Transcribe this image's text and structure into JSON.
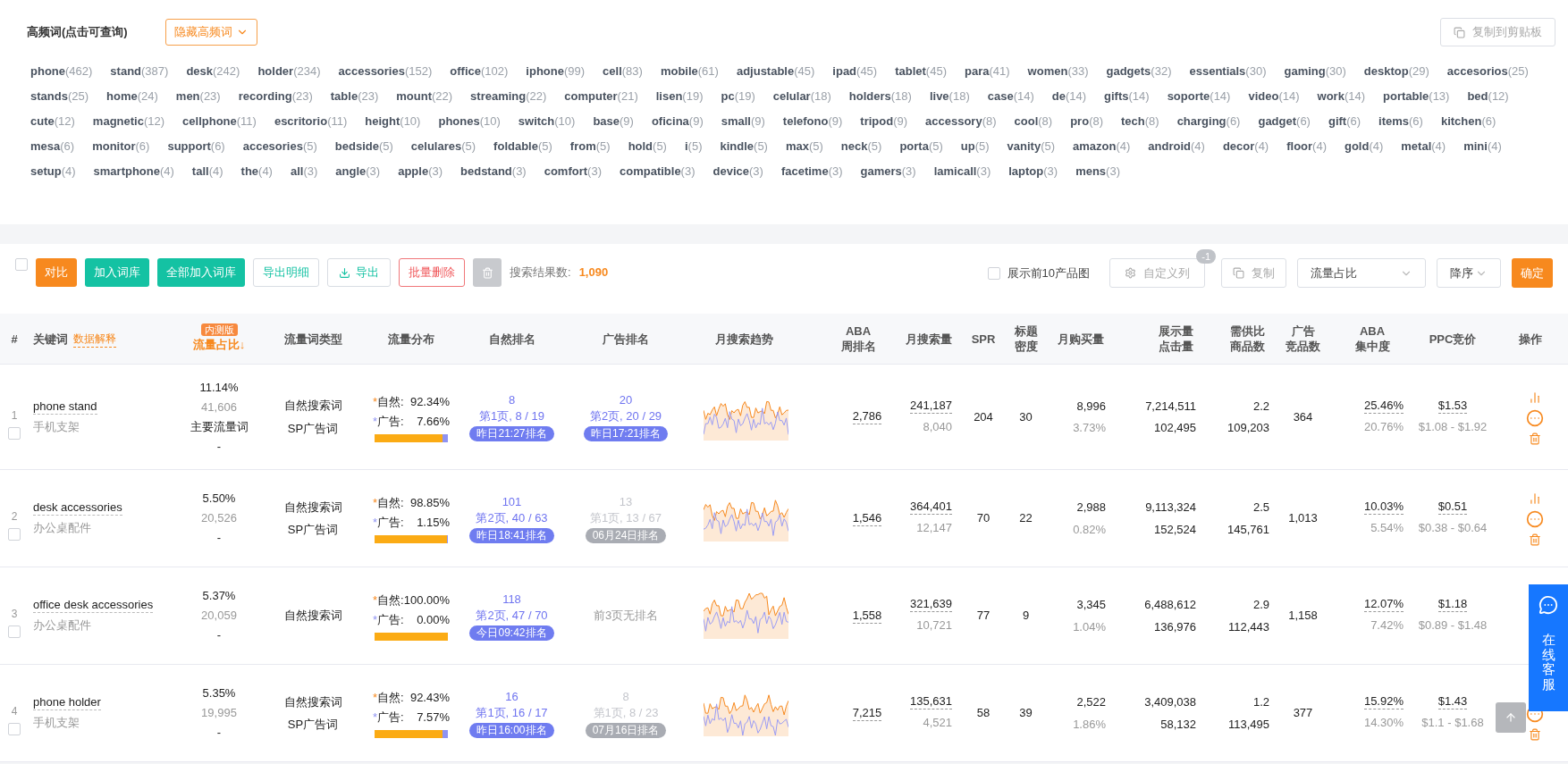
{
  "keywords_panel": {
    "title": "高频词(点击可查询)",
    "toggle_button": "隐藏高频词",
    "copy_button": "复制到剪贴板",
    "tags": [
      {
        "word": "phone",
        "count": "(462)"
      },
      {
        "word": "stand",
        "count": "(387)"
      },
      {
        "word": "desk",
        "count": "(242)"
      },
      {
        "word": "holder",
        "count": "(234)"
      },
      {
        "word": "accessories",
        "count": "(152)"
      },
      {
        "word": "office",
        "count": "(102)"
      },
      {
        "word": "iphone",
        "count": "(99)"
      },
      {
        "word": "cell",
        "count": "(83)"
      },
      {
        "word": "mobile",
        "count": "(61)"
      },
      {
        "word": "adjustable",
        "count": "(45)"
      },
      {
        "word": "ipad",
        "count": "(45)"
      },
      {
        "word": "tablet",
        "count": "(45)"
      },
      {
        "word": "para",
        "count": "(41)"
      },
      {
        "word": "women",
        "count": "(33)"
      },
      {
        "word": "gadgets",
        "count": "(32)"
      },
      {
        "word": "essentials",
        "count": "(30)"
      },
      {
        "word": "gaming",
        "count": "(30)"
      },
      {
        "word": "desktop",
        "count": "(29)"
      },
      {
        "word": "accesorios",
        "count": "(25)"
      },
      {
        "word": "stands",
        "count": "(25)"
      },
      {
        "word": "home",
        "count": "(24)"
      },
      {
        "word": "men",
        "count": "(23)"
      },
      {
        "word": "recording",
        "count": "(23)"
      },
      {
        "word": "table",
        "count": "(23)"
      },
      {
        "word": "mount",
        "count": "(22)"
      },
      {
        "word": "streaming",
        "count": "(22)"
      },
      {
        "word": "computer",
        "count": "(21)"
      },
      {
        "word": "lisen",
        "count": "(19)"
      },
      {
        "word": "pc",
        "count": "(19)"
      },
      {
        "word": "celular",
        "count": "(18)"
      },
      {
        "word": "holders",
        "count": "(18)"
      },
      {
        "word": "live",
        "count": "(18)"
      },
      {
        "word": "case",
        "count": "(14)"
      },
      {
        "word": "de",
        "count": "(14)"
      },
      {
        "word": "gifts",
        "count": "(14)"
      },
      {
        "word": "soporte",
        "count": "(14)"
      },
      {
        "word": "video",
        "count": "(14)"
      },
      {
        "word": "work",
        "count": "(14)"
      },
      {
        "word": "portable",
        "count": "(13)"
      },
      {
        "word": "bed",
        "count": "(12)"
      },
      {
        "word": "cute",
        "count": "(12)"
      },
      {
        "word": "magnetic",
        "count": "(12)"
      },
      {
        "word": "cellphone",
        "count": "(11)"
      },
      {
        "word": "escritorio",
        "count": "(11)"
      },
      {
        "word": "height",
        "count": "(10)"
      },
      {
        "word": "phones",
        "count": "(10)"
      },
      {
        "word": "switch",
        "count": "(10)"
      },
      {
        "word": "base",
        "count": "(9)"
      },
      {
        "word": "oficina",
        "count": "(9)"
      },
      {
        "word": "small",
        "count": "(9)"
      },
      {
        "word": "telefono",
        "count": "(9)"
      },
      {
        "word": "tripod",
        "count": "(9)"
      },
      {
        "word": "accessory",
        "count": "(8)"
      },
      {
        "word": "cool",
        "count": "(8)"
      },
      {
        "word": "pro",
        "count": "(8)"
      },
      {
        "word": "tech",
        "count": "(8)"
      },
      {
        "word": "charging",
        "count": "(6)"
      },
      {
        "word": "gadget",
        "count": "(6)"
      },
      {
        "word": "gift",
        "count": "(6)"
      },
      {
        "word": "items",
        "count": "(6)"
      },
      {
        "word": "kitchen",
        "count": "(6)"
      },
      {
        "word": "mesa",
        "count": "(6)"
      },
      {
        "word": "monitor",
        "count": "(6)"
      },
      {
        "word": "support",
        "count": "(6)"
      },
      {
        "word": "accesories",
        "count": "(5)"
      },
      {
        "word": "bedside",
        "count": "(5)"
      },
      {
        "word": "celulares",
        "count": "(5)"
      },
      {
        "word": "foldable",
        "count": "(5)"
      },
      {
        "word": "from",
        "count": "(5)"
      },
      {
        "word": "hold",
        "count": "(5)"
      },
      {
        "word": "i",
        "count": "(5)"
      },
      {
        "word": "kindle",
        "count": "(5)"
      },
      {
        "word": "max",
        "count": "(5)"
      },
      {
        "word": "neck",
        "count": "(5)"
      },
      {
        "word": "porta",
        "count": "(5)"
      },
      {
        "word": "up",
        "count": "(5)"
      },
      {
        "word": "vanity",
        "count": "(5)"
      },
      {
        "word": "amazon",
        "count": "(4)"
      },
      {
        "word": "android",
        "count": "(4)"
      },
      {
        "word": "decor",
        "count": "(4)"
      },
      {
        "word": "floor",
        "count": "(4)"
      },
      {
        "word": "gold",
        "count": "(4)"
      },
      {
        "word": "metal",
        "count": "(4)"
      },
      {
        "word": "mini",
        "count": "(4)"
      },
      {
        "word": "setup",
        "count": "(4)"
      },
      {
        "word": "smartphone",
        "count": "(4)"
      },
      {
        "word": "tall",
        "count": "(4)"
      },
      {
        "word": "the",
        "count": "(4)"
      },
      {
        "word": "all",
        "count": "(3)"
      },
      {
        "word": "angle",
        "count": "(3)"
      },
      {
        "word": "apple",
        "count": "(3)"
      },
      {
        "word": "bedstand",
        "count": "(3)"
      },
      {
        "word": "comfort",
        "count": "(3)"
      },
      {
        "word": "compatible",
        "count": "(3)"
      },
      {
        "word": "device",
        "count": "(3)"
      },
      {
        "word": "facetime",
        "count": "(3)"
      },
      {
        "word": "gamers",
        "count": "(3)"
      },
      {
        "word": "lamicall",
        "count": "(3)"
      },
      {
        "word": "laptop",
        "count": "(3)"
      },
      {
        "word": "mens",
        "count": "(3)"
      }
    ]
  },
  "toolbar": {
    "select_all": {
      "checked": false
    },
    "buttons": [
      {
        "label": "对比",
        "kind": "orange"
      },
      {
        "label": "加入词库",
        "kind": "green"
      },
      {
        "label": "全部加入词库",
        "kind": "green"
      },
      {
        "label": "导出明细",
        "kind": "outline-green"
      },
      {
        "label": "导出",
        "kind": "download"
      },
      {
        "label": "批量删除",
        "kind": "outline-red"
      },
      {
        "kind": "trash"
      }
    ],
    "result_label": "搜索结果数:",
    "result_count": "1,090",
    "show_images": {
      "label": "展示前10产品图",
      "checked": false
    },
    "custom_columns": {
      "label": "自定义列",
      "badge": "-1"
    },
    "copy_button": "复制",
    "sort_field": "流量占比",
    "sort_order": "降序",
    "confirm_button": "确定"
  },
  "table": {
    "columns": [
      {
        "lines": [
          "#"
        ]
      },
      {
        "lines": [
          "关键词"
        ],
        "link": "数据解释"
      },
      {
        "lines": [
          "流量占比↓"
        ],
        "badge": "内测版",
        "selected": true
      },
      {
        "lines": [
          "流量词类型"
        ]
      },
      {
        "lines": [
          "流量分布"
        ]
      },
      {
        "lines": [
          "自然排名"
        ]
      },
      {
        "lines": [
          "广告排名"
        ]
      },
      {
        "lines": [
          "月搜索趋势"
        ]
      },
      {
        "lines": [
          "ABA",
          "周排名"
        ]
      },
      {
        "lines": [
          "月搜索量"
        ]
      },
      {
        "lines": [
          "SPR"
        ]
      },
      {
        "lines": [
          "标题",
          "密度"
        ]
      },
      {
        "lines": [
          "月购买量"
        ]
      },
      {
        "lines": [
          "展示量",
          "点击量"
        ]
      },
      {
        "lines": [
          "需供比",
          "商品数"
        ]
      },
      {
        "lines": [
          "广告",
          "竞品数"
        ]
      },
      {
        "lines": [
          "ABA",
          "集中度"
        ]
      },
      {
        "lines": [
          "PPC竞价"
        ]
      },
      {
        "lines": [
          "操作"
        ]
      }
    ],
    "rows": [
      {
        "index": "1",
        "checked": false,
        "keyword": "phone stand",
        "translation": "手机支架",
        "share": "11.14%",
        "share_count": "41,606",
        "share_tag": "主要流量词",
        "share_extra": "-",
        "types": [
          "自然搜索词",
          "SP广告词"
        ],
        "dist": {
          "natural_star": "*",
          "natural_label": "自然:",
          "natural": "92.34%",
          "ad_star": "*",
          "ad_label": "广告:",
          "ad": "7.66%",
          "level": 0.9234
        },
        "natural_rank": {
          "rank": "8",
          "page": "第1页, 8 / 19",
          "time": "昨日21:27排名",
          "active": true
        },
        "ad_rank": {
          "rank": "20",
          "page": "第2页, 20 / 29",
          "time": "昨日17:21排名",
          "active": true
        },
        "aba": "2,786",
        "search": "241,187",
        "search_sub": "8,040",
        "spr": "204",
        "title_density": "30",
        "purchase": "8,996",
        "purchase_rate": "3.73%",
        "impressions": "7,214,511",
        "clicks": "102,495",
        "ratio": "2.2",
        "products": "109,203",
        "ad_products": "364",
        "aba_conc": "25.46%",
        "aba_conc_sub": "20.76%",
        "ppc": "$1.53",
        "ppc_range": "$1.08 - $1.92",
        "actions": [
          {
            "kind": "chart"
          },
          {
            "kind": "more"
          },
          {
            "kind": "delete"
          }
        ]
      },
      {
        "index": "2",
        "checked": false,
        "keyword": "desk accessories",
        "translation": "办公桌配件",
        "share": "5.50%",
        "share_count": "20,526",
        "share_extra": "-",
        "types": [
          "自然搜索词",
          "SP广告词"
        ],
        "dist": {
          "natural_star": "*",
          "natural_label": "自然:",
          "natural": "98.85%",
          "ad_star": "*",
          "ad_label": "广告:",
          "ad": "1.15%",
          "level": 0.9885
        },
        "natural_rank": {
          "rank": "101",
          "page": "第2页, 40 / 63",
          "time": "昨日18:41排名",
          "active": true
        },
        "ad_rank": {
          "rank": "13",
          "page": "第1页, 13 / 67",
          "time": "06月24日排名",
          "active": false
        },
        "aba": "1,546",
        "search": "364,401",
        "search_sub": "12,147",
        "spr": "70",
        "title_density": "22",
        "purchase": "2,988",
        "purchase_rate": "0.82%",
        "impressions": "9,113,324",
        "clicks": "152,524",
        "ratio": "2.5",
        "products": "145,761",
        "ad_products": "1,013",
        "aba_conc": "10.03%",
        "aba_conc_sub": "5.54%",
        "ppc": "$0.51",
        "ppc_range": "$0.38 - $0.64",
        "actions": [
          {
            "kind": "chart"
          },
          {
            "kind": "more"
          },
          {
            "kind": "delete"
          }
        ]
      },
      {
        "index": "3",
        "checked": false,
        "keyword": "office desk accessories",
        "translation": "办公桌配件",
        "share": "5.37%",
        "share_count": "20,059",
        "share_extra": "-",
        "types": [
          "自然搜索词"
        ],
        "dist": {
          "natural_star": "*",
          "natural_label": "自然:",
          "natural": "100.00%",
          "ad_star": "*",
          "ad_label": "广告:",
          "ad": "0.00%",
          "level": 1
        },
        "natural_rank": {
          "rank": "118",
          "page": "第2页, 47 / 70",
          "time": "今日09:42排名",
          "active": true
        },
        "ad_rank": {
          "note": "前3页无排名"
        },
        "aba": "1,558",
        "search": "321,639",
        "search_sub": "10,721",
        "spr": "77",
        "title_density": "9",
        "purchase": "3,345",
        "purchase_rate": "1.04%",
        "impressions": "6,488,612",
        "clicks": "136,976",
        "ratio": "2.9",
        "products": "112,443",
        "ad_products": "1,158",
        "aba_conc": "12.07%",
        "aba_conc_sub": "7.42%",
        "ppc": "$1.18",
        "ppc_range": "$0.89 - $1.48"
      },
      {
        "index": "4",
        "checked": false,
        "keyword": "phone holder",
        "translation": "手机支架",
        "share": "5.35%",
        "share_count": "19,995",
        "share_extra": "-",
        "types": [
          "自然搜索词",
          "SP广告词"
        ],
        "dist": {
          "natural_star": "*",
          "natural_label": "自然:",
          "natural": "92.43%",
          "ad_star": "*",
          "ad_label": "广告:",
          "ad": "7.57%",
          "level": 0.9243
        },
        "natural_rank": {
          "rank": "16",
          "page": "第1页, 16 / 17",
          "time": "昨日16:00排名",
          "active": true
        },
        "ad_rank": {
          "rank": "8",
          "page": "第1页, 8 / 23",
          "time": "07月16日排名",
          "active": false
        },
        "aba": "7,215",
        "search": "135,631",
        "search_sub": "4,521",
        "spr": "58",
        "title_density": "39",
        "purchase": "2,522",
        "purchase_rate": "1.86%",
        "impressions": "3,409,038",
        "clicks": "58,132",
        "ratio": "1.2",
        "products": "113,495",
        "ad_products": "377",
        "aba_conc": "15.92%",
        "aba_conc_sub": "14.30%",
        "ppc": "$1.43",
        "ppc_range": "$1.1 - $1.68",
        "actions": [
          {
            "kind": "more"
          },
          {
            "kind": "delete"
          }
        ]
      }
    ]
  },
  "support_widget": {
    "label": "在线客服"
  }
}
